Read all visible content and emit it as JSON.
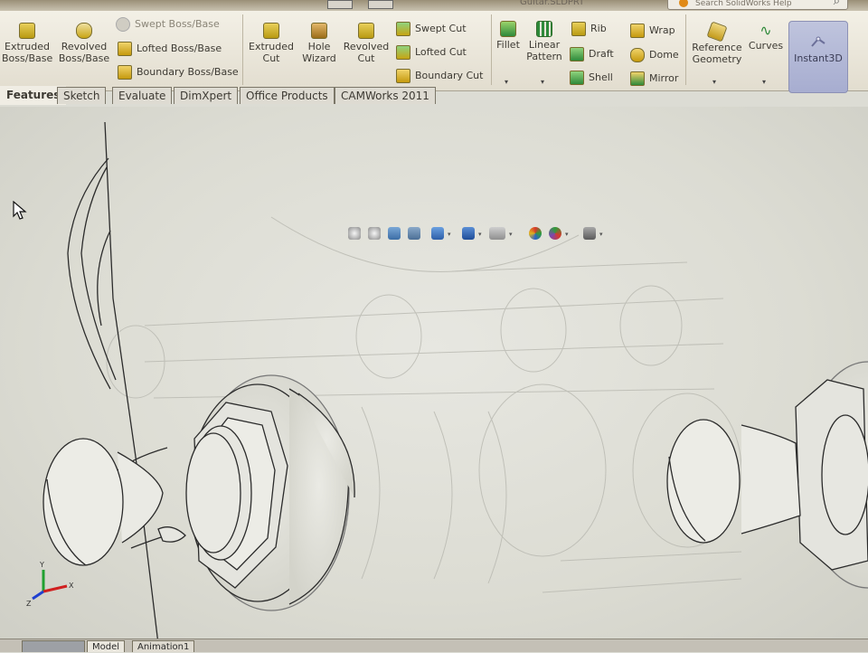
{
  "window": {
    "title": "Guitar.SLDPRT",
    "search_placeholder": "Search SolidWorks Help"
  },
  "ribbon": {
    "extruded_boss": "Extruded\nBoss/Base",
    "extruded_boss_l1": "Extruded",
    "extruded_boss_l2": "Boss/Base",
    "revolved_boss_l1": "Revolved",
    "revolved_boss_l2": "Boss/Base",
    "swept_boss": "Swept Boss/Base",
    "lofted_boss": "Lofted Boss/Base",
    "boundary_boss": "Boundary Boss/Base",
    "extruded_cut_l1": "Extruded",
    "extruded_cut_l2": "Cut",
    "hole_wizard_l1": "Hole",
    "hole_wizard_l2": "Wizard",
    "revolved_cut_l1": "Revolved",
    "revolved_cut_l2": "Cut",
    "swept_cut": "Swept Cut",
    "lofted_cut": "Lofted Cut",
    "boundary_cut": "Boundary Cut",
    "fillet": "Fillet",
    "linear_pattern_l1": "Linear",
    "linear_pattern_l2": "Pattern",
    "rib": "Rib",
    "draft": "Draft",
    "shell": "Shell",
    "wrap": "Wrap",
    "dome": "Dome",
    "mirror": "Mirror",
    "reference_geometry_l1": "Reference",
    "reference_geometry_l2": "Geometry",
    "curves": "Curves",
    "instant3d": "Instant3D"
  },
  "tabs": [
    "Features",
    "Sketch",
    "Evaluate",
    "DimXpert",
    "Office Products",
    "CAMWorks 2011"
  ],
  "bottom_tabs": [
    "Model",
    "Animation1"
  ],
  "triad": {
    "x": "X",
    "y": "Y",
    "z": "Z"
  },
  "colors": {
    "accent": "#e08a17",
    "instant3d_bg": "#aab0d2",
    "feature_icon": "#c9a514",
    "pattern_icon": "#2f8a3a",
    "triad_x": "#d02020",
    "triad_y": "#20a030",
    "triad_z": "#2040d0"
  },
  "icons": {
    "view_toolbar": [
      "zoom-to-fit-icon",
      "zoom-area-icon",
      "previous-view-icon",
      "section-view-icon",
      "view-orientation-icon",
      "display-style-icon",
      "hide-show-icon",
      "edit-appearance-icon",
      "apply-scene-icon",
      "view-settings-icon"
    ]
  }
}
